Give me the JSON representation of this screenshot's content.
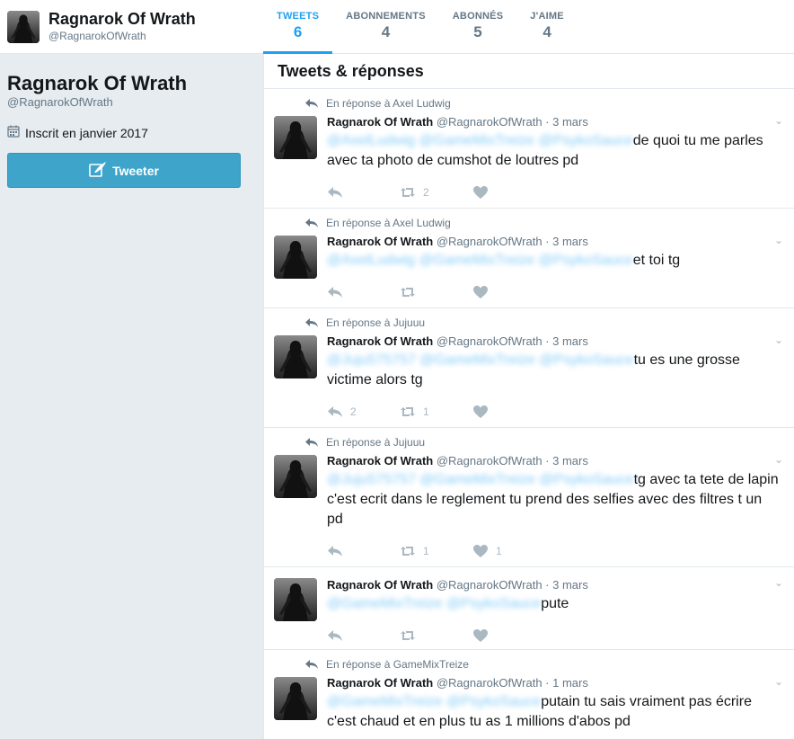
{
  "profile": {
    "name": "Ragnarok Of Wrath",
    "handle": "@RagnarokOfWrath",
    "joined": "Inscrit en janvier 2017",
    "tweet_button": "Tweeter"
  },
  "nav": [
    {
      "label": "TWEETS",
      "count": "6",
      "active": true
    },
    {
      "label": "ABONNEMENTS",
      "count": "4",
      "active": false
    },
    {
      "label": "ABONNÉS",
      "count": "5",
      "active": false
    },
    {
      "label": "J'AIME",
      "count": "4",
      "active": false
    }
  ],
  "timeline": {
    "title": "Tweets & réponses",
    "tweets": [
      {
        "reply_to": "En réponse à Axel Ludwig",
        "name": "Ragnarok Of Wrath",
        "meta": "@RagnarokOfWrath · 3 mars",
        "mentions": "@AxelLudwig @GameMixTreize @PsykoSauce",
        "text": "de quoi tu me parles avec ta photo de cumshot de loutres pd",
        "replies": "",
        "retweets": "2",
        "likes": ""
      },
      {
        "reply_to": "En réponse à Axel Ludwig",
        "name": "Ragnarok Of Wrath",
        "meta": "@RagnarokOfWrath · 3 mars",
        "mentions": "@AxelLudwig @GameMixTreize @PsykoSauce",
        "text": "et toi tg",
        "replies": "",
        "retweets": "",
        "likes": ""
      },
      {
        "reply_to": "En réponse à Jujuuu",
        "name": "Ragnarok Of Wrath",
        "meta": "@RagnarokOfWrath · 3 mars",
        "mentions": "@Juju575757 @GameMixTreize @PsykoSauce",
        "text": "tu es une grosse victime alors tg",
        "replies": "2",
        "retweets": "1",
        "likes": ""
      },
      {
        "reply_to": "En réponse à Jujuuu",
        "name": "Ragnarok Of Wrath",
        "meta": "@RagnarokOfWrath · 3 mars",
        "mentions": "@Juju575757 @GameMixTreize @PsykoSauce",
        "text": "tg avec ta tete de lapin c'est ecrit dans le reglement tu prend des selfies avec des filtres t un pd",
        "replies": "",
        "retweets": "1",
        "likes": "1"
      },
      {
        "reply_to": "",
        "name": "Ragnarok Of Wrath",
        "meta": "@RagnarokOfWrath · 3 mars",
        "mentions": "@GameMixTreize @PsykoSauce",
        "text": "pute",
        "replies": "",
        "retweets": "",
        "likes": ""
      },
      {
        "reply_to": "En réponse à GameMixTreize",
        "name": "Ragnarok Of Wrath",
        "meta": "@RagnarokOfWrath · 1 mars",
        "mentions": "@GameMixTreize @PsykoSauce",
        "text": "putain tu sais vraiment pas écrire c'est chaud et en plus tu as 1 millions d'abos pd",
        "replies": "",
        "retweets": "",
        "likes": ""
      }
    ]
  },
  "colors": {
    "accent": "#1da1f2",
    "button": "#3ea4c9",
    "muted": "#657786",
    "icon": "#aab8c2"
  },
  "icons": [
    "reply-icon",
    "retweet-icon",
    "heart-icon",
    "chevron-down-icon",
    "calendar-icon",
    "quill-icon"
  ]
}
